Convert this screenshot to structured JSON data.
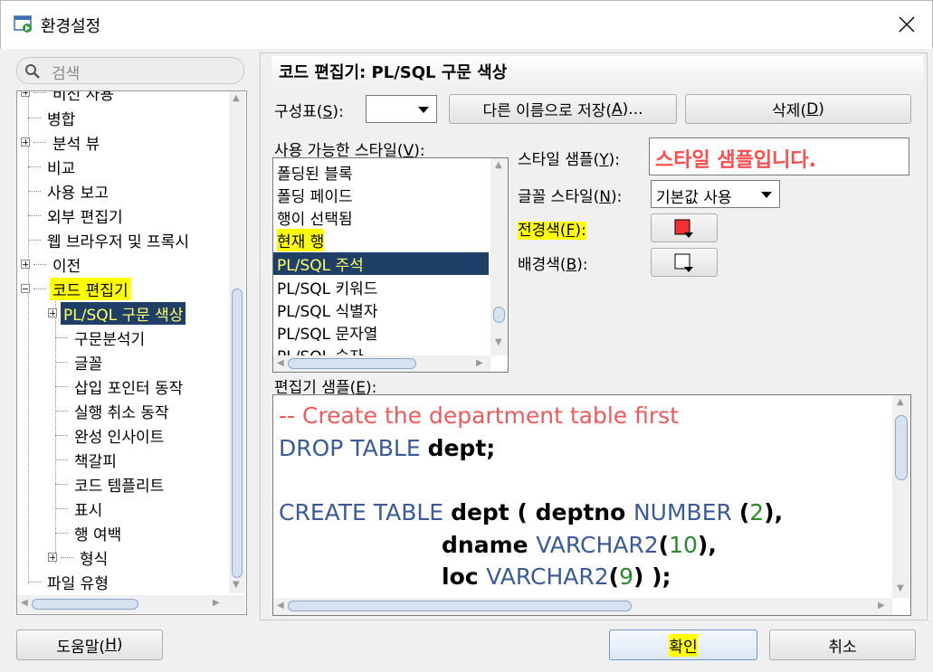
{
  "window": {
    "title": "환경설정",
    "close": "✕"
  },
  "search": {
    "placeholder": "검색"
  },
  "tree": {
    "partial_top": "비전 사용",
    "items": [
      {
        "label": "병합"
      },
      {
        "label": "분석 뷰"
      },
      {
        "label": "비교"
      },
      {
        "label": "사용 보고"
      },
      {
        "label": "외부 편집기"
      },
      {
        "label": "웹 브라우저 및 프록시"
      },
      {
        "label": "이전"
      },
      {
        "label": "코드 편집기"
      },
      {
        "label": "PL/SQL 구문 색상"
      },
      {
        "label": "구문분석기"
      },
      {
        "label": "글꼴"
      },
      {
        "label": "삽입 포인터 동작"
      },
      {
        "label": "실행 취소 동작"
      },
      {
        "label": "완성 인사이트"
      },
      {
        "label": "책갈피"
      },
      {
        "label": "코드 템플리트"
      },
      {
        "label": "표시"
      },
      {
        "label": "행 여백"
      },
      {
        "label": "형식"
      },
      {
        "label": "파일 유형"
      }
    ]
  },
  "panel": {
    "title": "코드 편집기: PL/SQL 구문 색상",
    "scheme_label": "구성표(",
    "scheme_key": "S",
    "scheme_label_end": "):",
    "saveas_label": "다른 이름으로 저장(",
    "saveas_key": "A",
    "saveas_end": ")...",
    "delete_label": "삭제(",
    "delete_key": "D",
    "delete_end": ")",
    "available_label": "사용 가능한 스타일(",
    "available_key": "V",
    "available_end": "):",
    "styles": [
      "폴딩된 블록",
      "폴딩 페이드",
      "행이 선택됨",
      "현재 행",
      "PL/SQL 주석",
      "PL/SQL 키워드",
      "PL/SQL 식별자",
      "PL/SQL 문자열",
      "PL/SQL 숫자"
    ],
    "style_sample_label": "스타일 샘플(",
    "style_sample_key": "Y",
    "style_sample_end": "):",
    "style_sample_text": "스타일 샘플입니다.",
    "font_style_label": "글꼴 스타일(",
    "font_style_key": "N",
    "font_style_end": "):",
    "font_style_value": "기본값 사용",
    "fg_label": "전경색(",
    "fg_key": "F",
    "fg_end": "):",
    "bg_label": "배경색(",
    "bg_key": "B",
    "bg_end": "):",
    "fg_color": "#f03030",
    "bg_color": "#ffffff",
    "editor_label": "편집기 샘플(",
    "editor_key": "E",
    "editor_end": "):"
  },
  "code": {
    "line1": "-- Create the department table first",
    "l2_kw": "DROP TABLE ",
    "l2_id": "dept;",
    "l4_kw": "CREATE TABLE ",
    "l4_id": "dept ( deptno ",
    "l4_kw2": "NUMBER ",
    "l4_p1": "(",
    "l4_num": "2",
    "l4_p2": "),",
    "l5_id": "dname ",
    "l5_kw": "VARCHAR2",
    "l5_p1": "(",
    "l5_num": "10",
    "l5_p2": "),",
    "l6_id": "loc ",
    "l6_kw": "VARCHAR2",
    "l6_p1": "(",
    "l6_num": "9",
    "l6_p2": ") );"
  },
  "footer": {
    "help_label": "도움말(",
    "help_key": "H",
    "help_end": ")",
    "ok_label": "확인",
    "cancel_label": "취소"
  },
  "colors": {
    "highlight": "#ffff00",
    "selection": "#1f3f66",
    "comment": "#f05a5a",
    "keyword": "#3a5a9a",
    "number": "#2a8a2a"
  }
}
